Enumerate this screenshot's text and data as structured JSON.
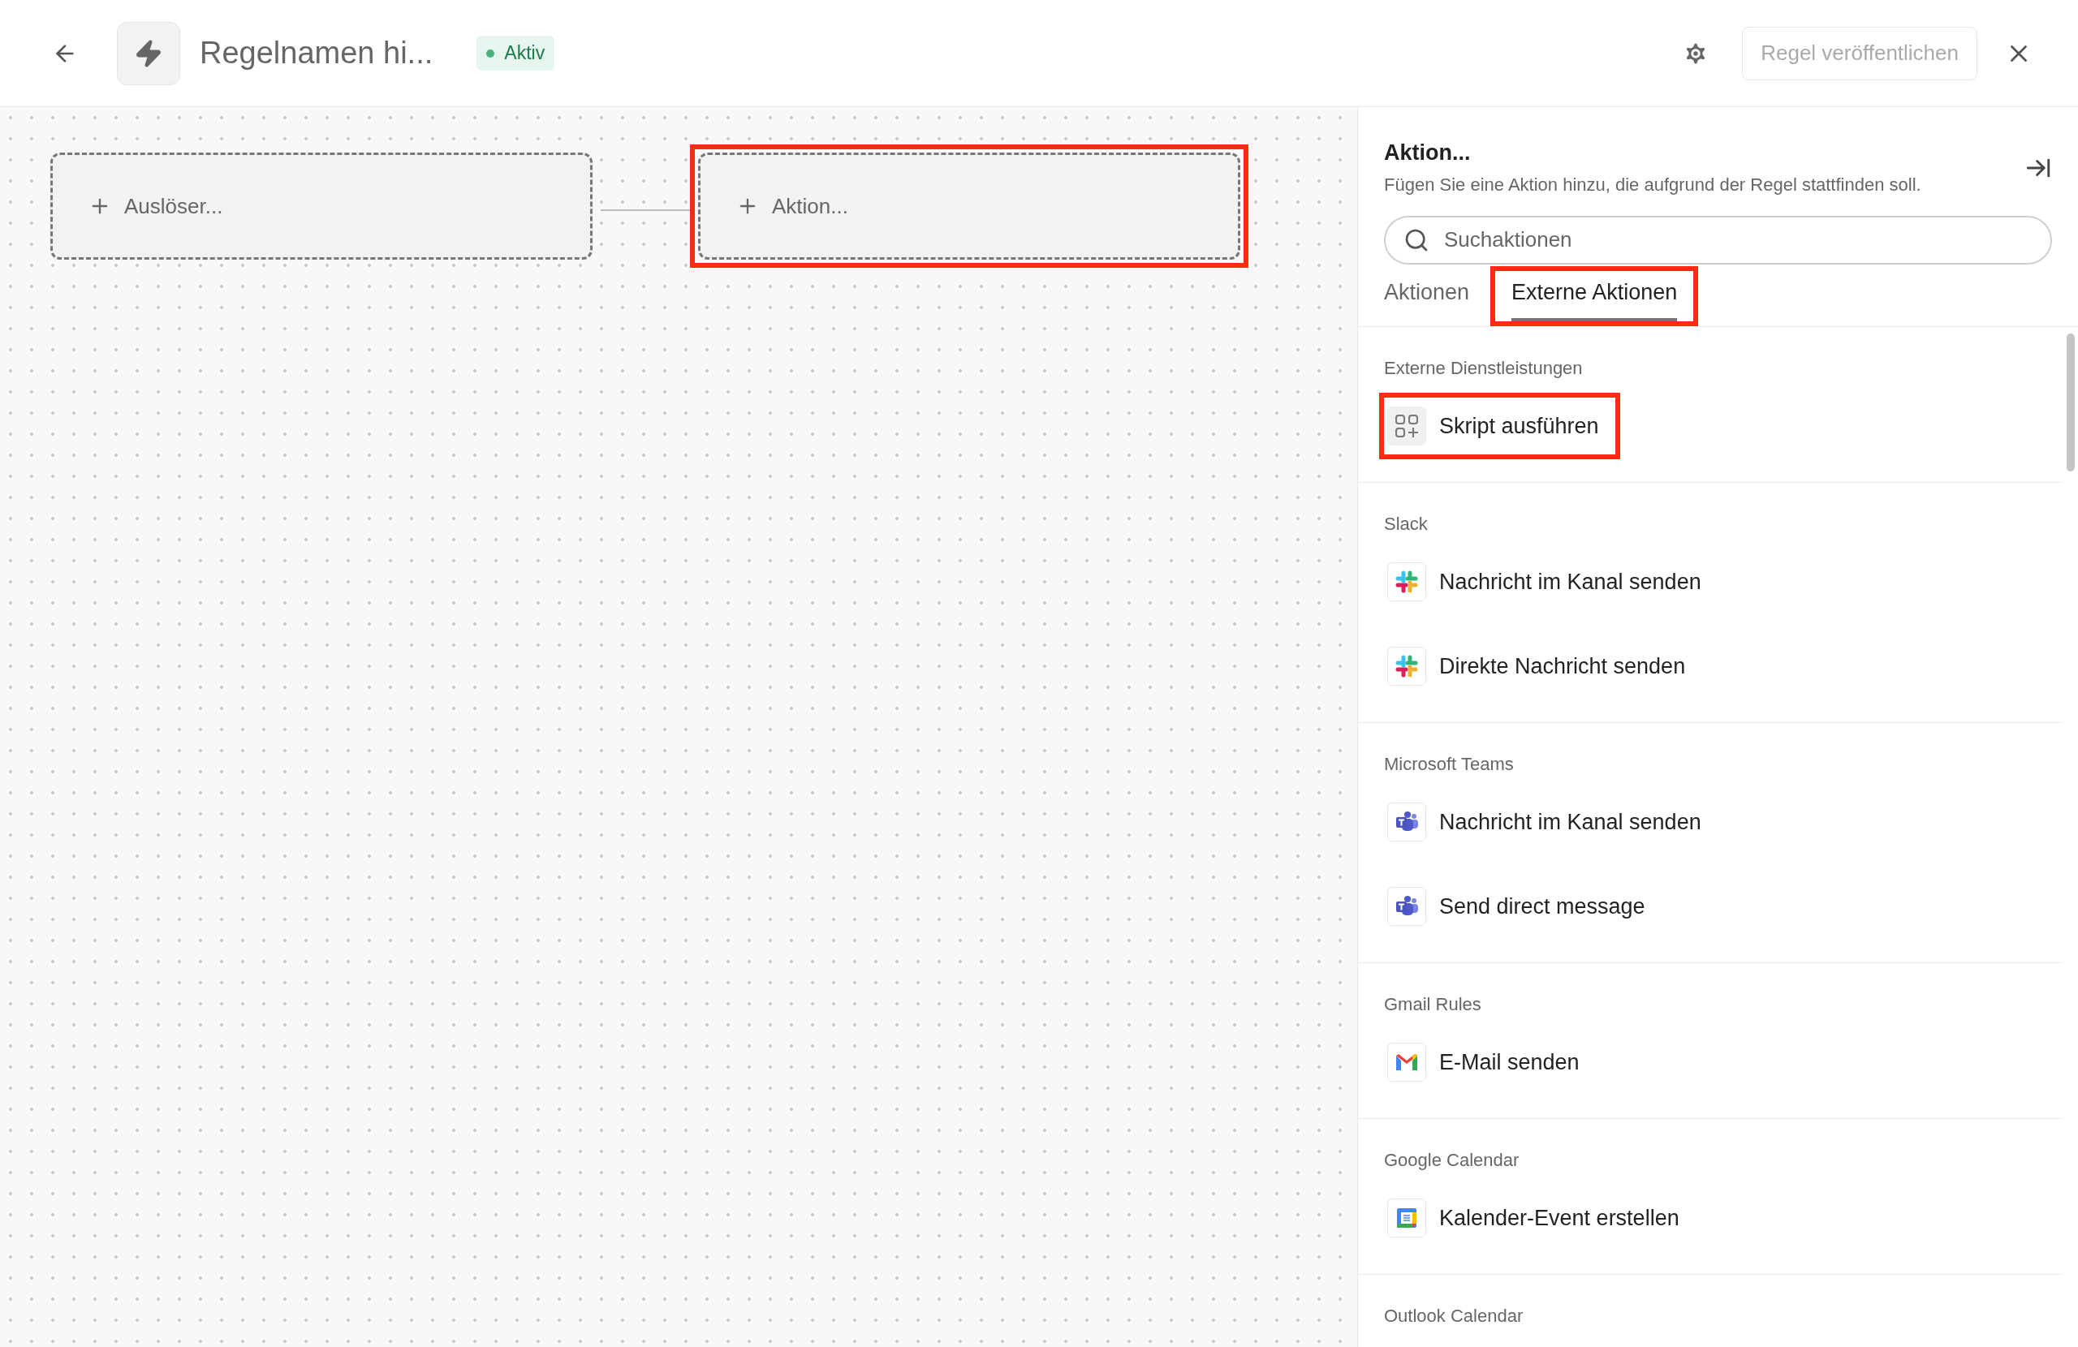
{
  "header": {
    "title": "Regelnamen hi...",
    "status": {
      "label": "Aktiv",
      "active": true
    },
    "publish_button": {
      "label": "Regel veröffentlichen",
      "disabled": true
    }
  },
  "canvas": {
    "nodes": [
      {
        "label": "Auslöser...",
        "highlighted": false
      },
      {
        "label": "Aktion...",
        "highlighted": true
      }
    ]
  },
  "panel": {
    "title": "Aktion...",
    "subtitle": "Fügen Sie eine Aktion hinzu, die aufgrund der Regel stattfinden soll.",
    "search": {
      "placeholder": "Suchaktionen"
    },
    "tabs": [
      {
        "label": "Aktionen",
        "selected": false,
        "highlighted": false
      },
      {
        "label": "Externe Aktionen",
        "selected": true,
        "highlighted": true
      }
    ],
    "sections": [
      {
        "title": "Externe Dienstleistungen",
        "items": [
          {
            "label": "Skript ausführen",
            "kind": "script",
            "highlighted": true
          }
        ]
      },
      {
        "title": "Slack",
        "items": [
          {
            "label": "Nachricht im Kanal senden",
            "kind": "slack",
            "highlighted": false
          },
          {
            "label": "Direkte Nachricht senden",
            "kind": "slack",
            "highlighted": false
          }
        ]
      },
      {
        "title": "Microsoft Teams",
        "items": [
          {
            "label": "Nachricht im Kanal senden",
            "kind": "teams",
            "highlighted": false
          },
          {
            "label": "Send direct message",
            "kind": "teams",
            "highlighted": false
          }
        ]
      },
      {
        "title": "Gmail Rules",
        "items": [
          {
            "label": "E-Mail senden",
            "kind": "gmail",
            "highlighted": false
          }
        ]
      },
      {
        "title": "Google Calendar",
        "items": [
          {
            "label": "Kalender-Event erstellen",
            "kind": "gcal",
            "highlighted": false
          }
        ]
      },
      {
        "title": "Outlook Calendar"
      }
    ]
  }
}
